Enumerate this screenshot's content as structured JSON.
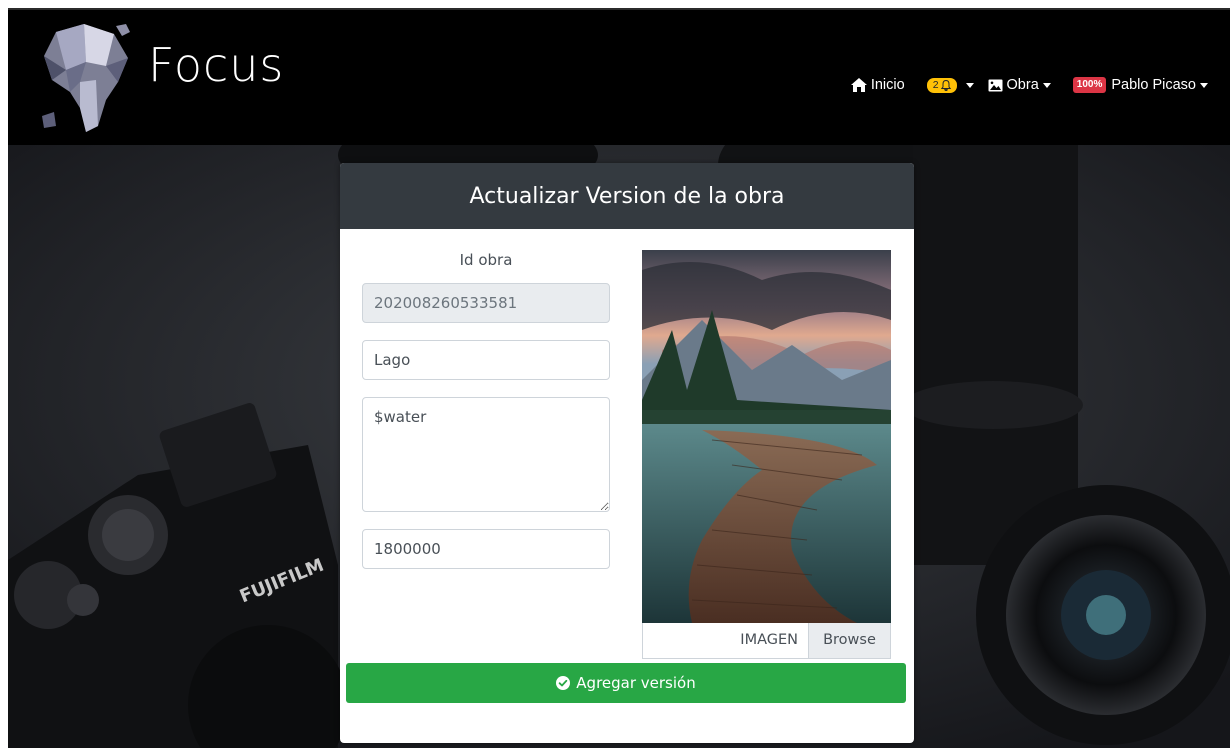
{
  "brand": {
    "name": "Focus",
    "logo": "elephant-logo"
  },
  "nav": {
    "home": {
      "label": "Inicio",
      "icon": "home-icon"
    },
    "notifications": {
      "count": "2",
      "icon": "bell-icon"
    },
    "obra": {
      "label": "Obra",
      "icon": "image-icon"
    },
    "user": {
      "progress": "100%",
      "name": "Pablo Picaso"
    }
  },
  "card": {
    "title": "Actualizar Version de la obra",
    "id_label": "Id obra",
    "fields": {
      "id_value": "202008260533581",
      "name_value": "Lago",
      "description_value": "$water",
      "price_value": "1800000"
    },
    "file": {
      "label": "IMAGEN",
      "browse": "Browse"
    },
    "submit": {
      "label": "Agregar versión",
      "icon": "check-circle-icon"
    }
  },
  "colors": {
    "navbar": "#000000",
    "card_header": "#343a40",
    "success": "#28a745",
    "badge_warning": "#ffc107",
    "badge_danger": "#dc3545"
  }
}
